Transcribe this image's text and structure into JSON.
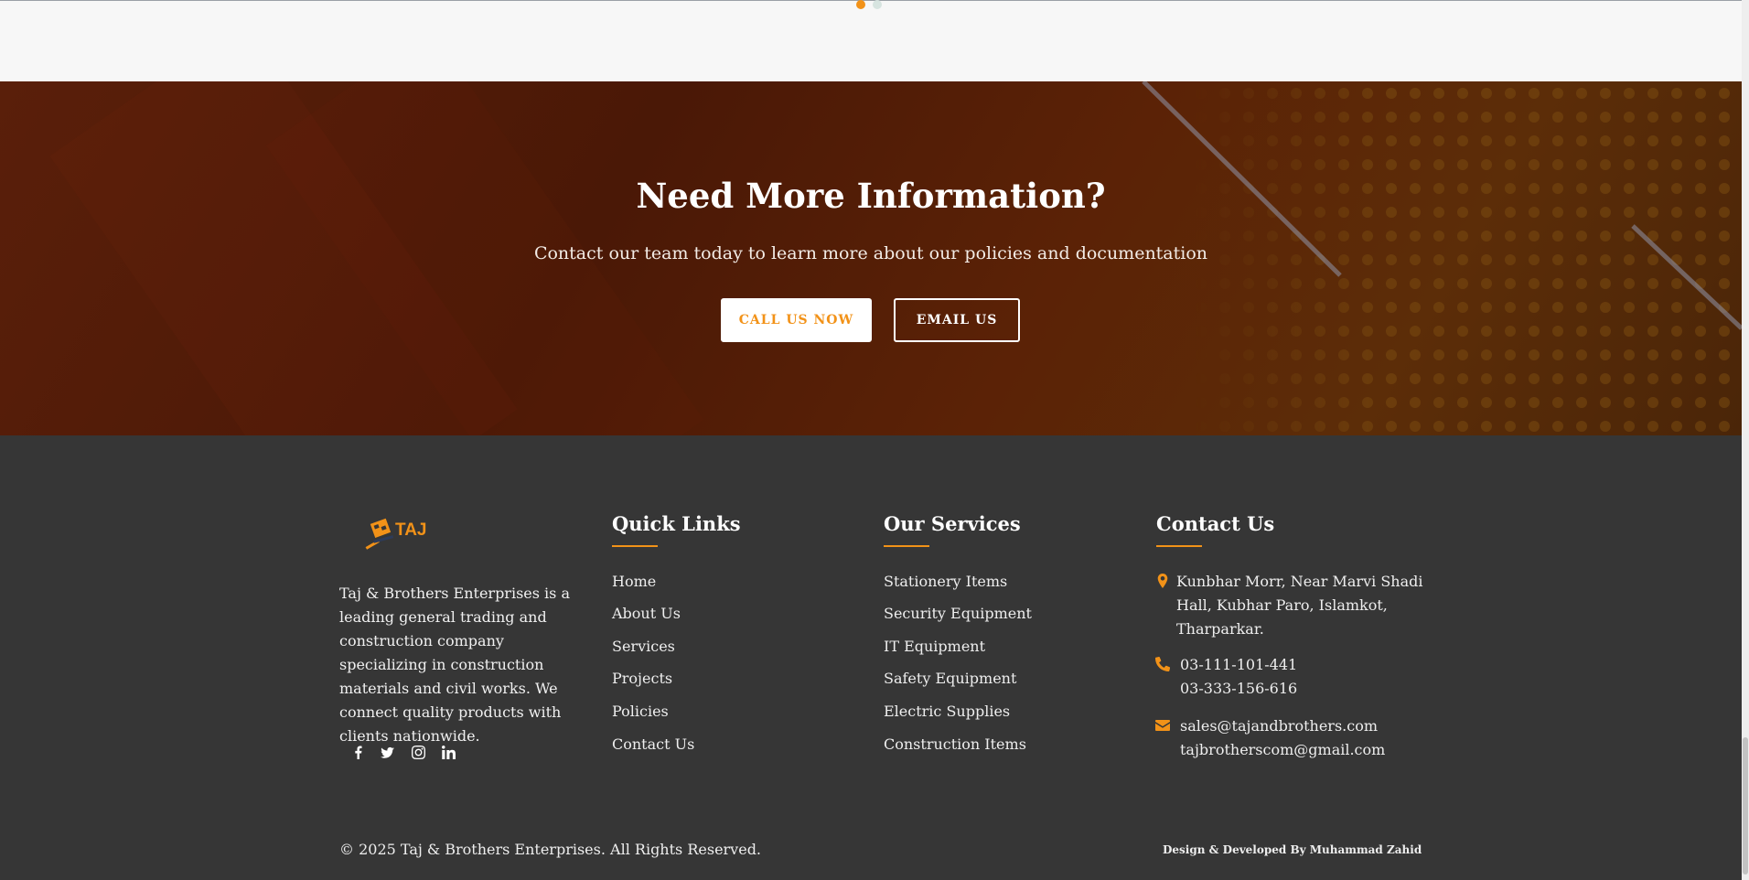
{
  "slider": {
    "active_dot_color": "#f29218",
    "inactive_dot_color": "#d7e4e0"
  },
  "cta": {
    "title": "Need More Information?",
    "subtitle": "Contact our team today to learn more about our policies and documentation",
    "call_label": "CALL US NOW",
    "email_label": "EMAIL US"
  },
  "footer": {
    "logo_text": "TAJ",
    "about": "Taj & Brothers Enterprises is a leading general trading and construction company specializing in construction materials and civil works. We connect quality products with clients nationwide.",
    "social": [
      {
        "icon": "facebook-icon"
      },
      {
        "icon": "twitter-icon"
      },
      {
        "icon": "instagram-icon"
      },
      {
        "icon": "linkedin-icon"
      }
    ],
    "quick_links": {
      "title": "Quick Links",
      "items": [
        "Home",
        "About Us",
        "Services",
        "Projects",
        "Policies",
        "Contact Us"
      ]
    },
    "services": {
      "title": "Our Services",
      "items": [
        "Stationery Items",
        "Security Equipment",
        "IT Equipment",
        "Safety Equipment",
        "Electric Supplies",
        "Construction Items"
      ]
    },
    "contact": {
      "title": "Contact Us",
      "address_lines": [
        "Kunbhar Morr, Near Marvi Shadi",
        "Hall, Kubhar Paro, Islamkot,",
        "Tharparkar."
      ],
      "phones": [
        "03-111-101-441",
        "03-333-156-616"
      ],
      "emails": [
        "sales@tajandbrothers.com",
        "tajbrotherscom@gmail.com"
      ]
    },
    "copyright": "© 2025 Taj & Brothers Enterprises. All Rights Reserved.",
    "credit": "Design & Developed By  Muhammad Zahid"
  },
  "colors": {
    "accent": "#f29218",
    "footer_bg": "#363636",
    "cta_bg": "#4a1806"
  }
}
